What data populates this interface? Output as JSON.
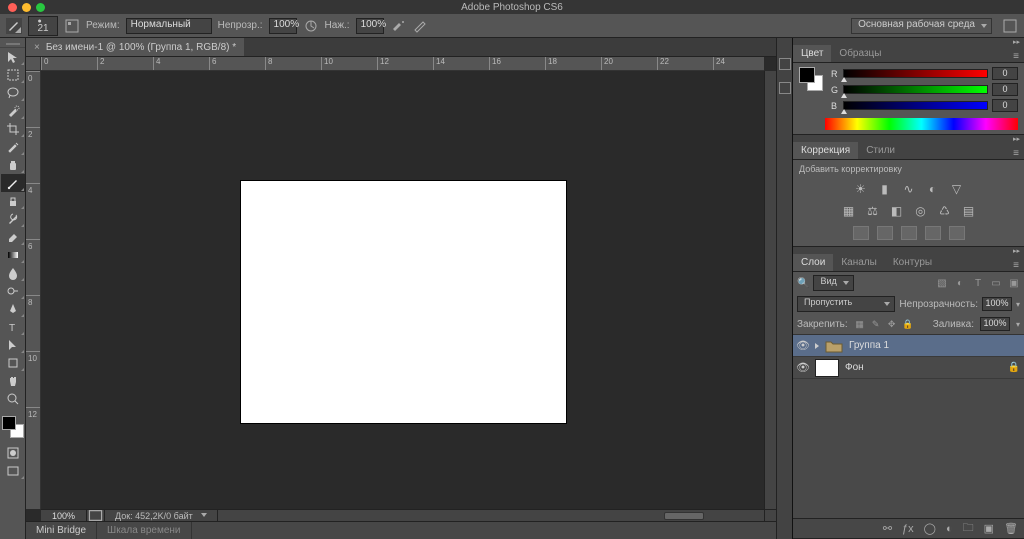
{
  "app": {
    "name": "Adobe Photoshop CS6"
  },
  "options_bar": {
    "brush_size": "21",
    "mode_label": "Режим:",
    "mode_value": "Нормальный",
    "opacity_label": "Непрозр.:",
    "opacity_value": "100%",
    "flow_label": "Наж.:",
    "flow_value": "100%",
    "workspace": "Основная рабочая среда"
  },
  "document": {
    "tab_title": "Без имени-1 @ 100% (Группа 1, RGB/8) *",
    "zoom": "100%",
    "status_doc": "Док: 452,2K/0 байт"
  },
  "ruler_h": [
    "0",
    "2",
    "4",
    "6",
    "8",
    "10",
    "12",
    "14",
    "16",
    "18",
    "20",
    "22",
    "24"
  ],
  "ruler_v": [
    "0",
    "2",
    "4",
    "6",
    "8",
    "10",
    "12"
  ],
  "bottom_tabs": {
    "mini_bridge": "Mini Bridge",
    "timeline": "Шкала времени"
  },
  "color_panel": {
    "tab_color": "Цвет",
    "tab_swatches": "Образцы",
    "r_label": "R",
    "g_label": "G",
    "b_label": "B",
    "r": "0",
    "g": "0",
    "b": "0"
  },
  "adjustments_panel": {
    "tab_adjustments": "Коррекция",
    "tab_styles": "Стили",
    "hint": "Добавить корректировку"
  },
  "layers_panel": {
    "tab_layers": "Слои",
    "tab_channels": "Каналы",
    "tab_paths": "Контуры",
    "kind_filter": "Вид",
    "blend_mode": "Пропустить",
    "opacity_label": "Непрозрачность:",
    "opacity_value": "100%",
    "lock_label": "Закрепить:",
    "fill_label": "Заливка:",
    "fill_value": "100%",
    "layers": [
      {
        "name": "Группа 1",
        "type": "group",
        "selected": true
      },
      {
        "name": "Фон",
        "type": "bg",
        "locked": true
      }
    ]
  },
  "colors": {
    "canvas_bg": "#2a2a2a",
    "panel_bg": "#555555",
    "selected_layer": "#5a6d8a"
  }
}
